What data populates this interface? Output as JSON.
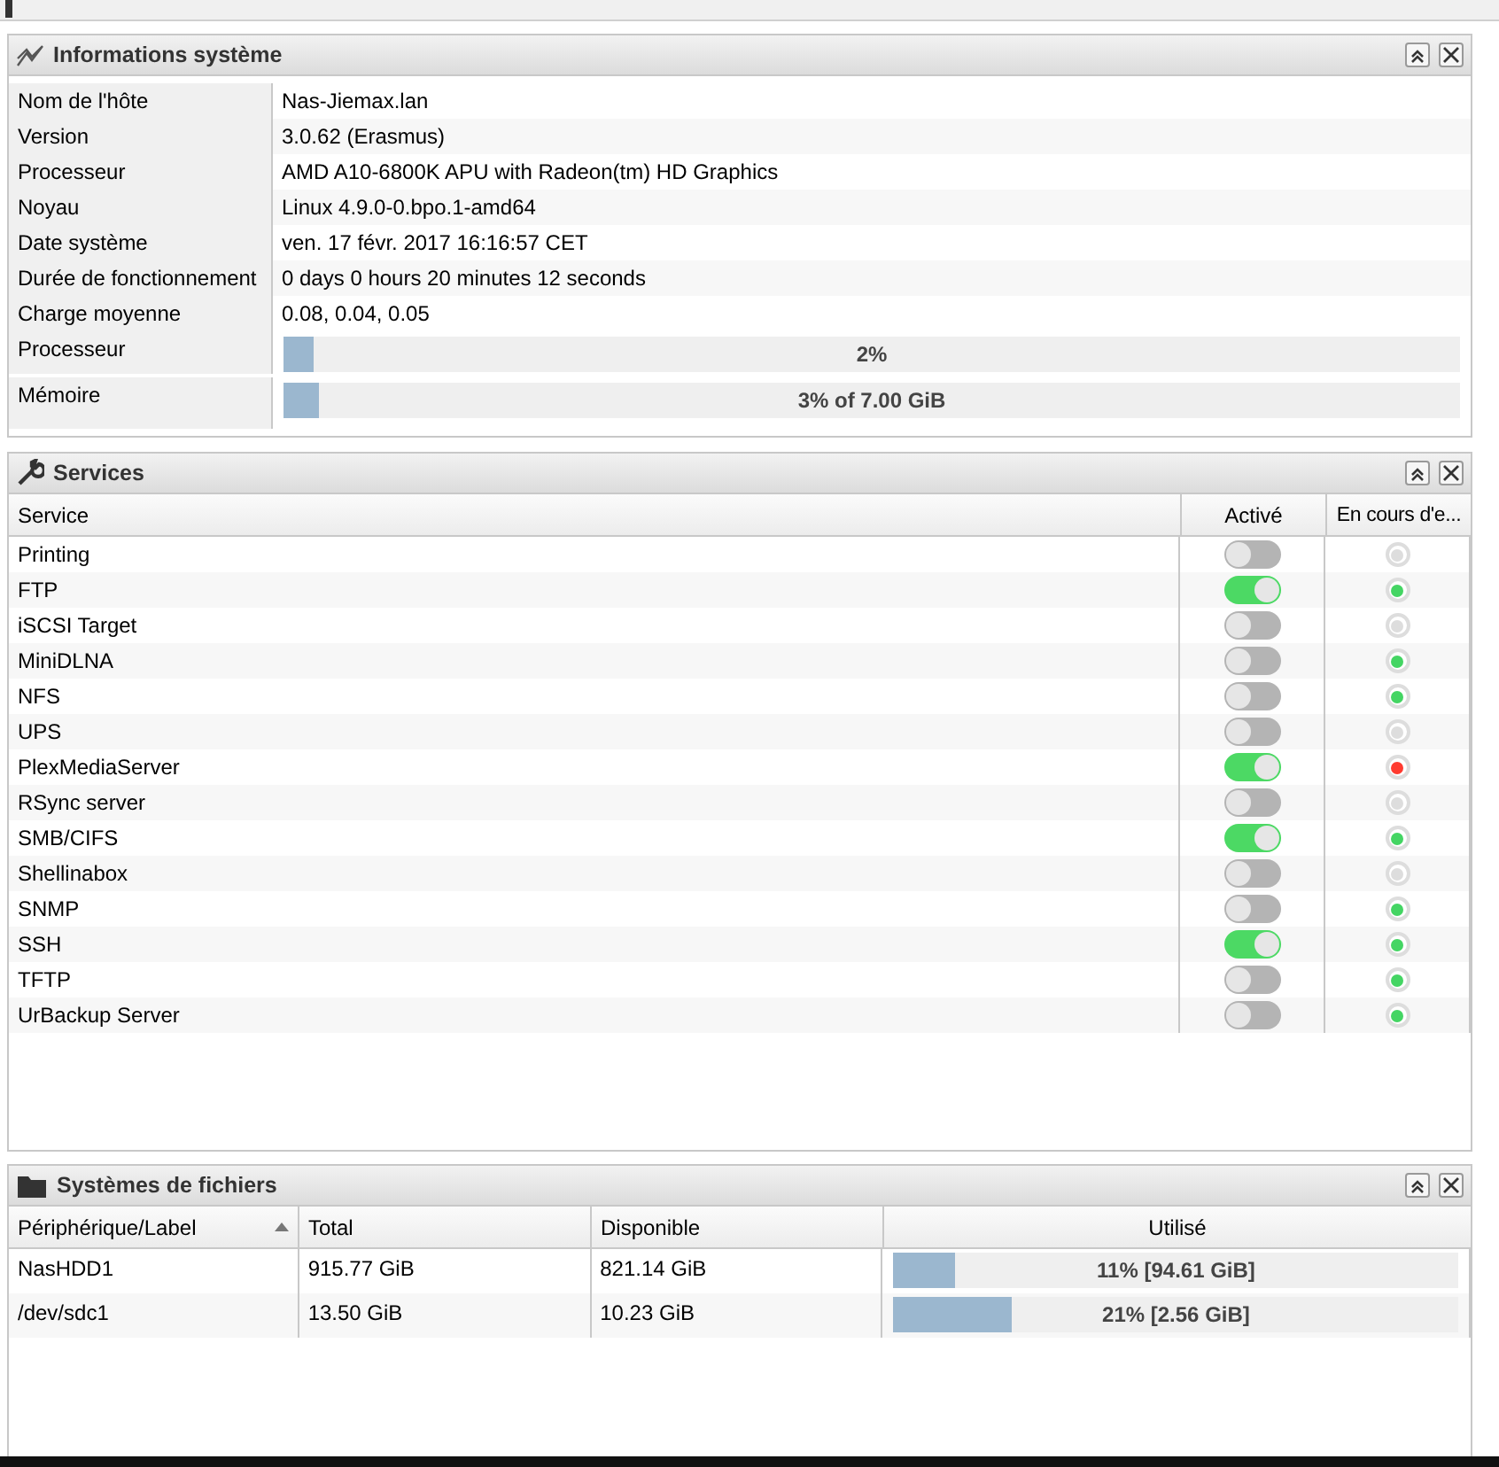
{
  "system_panel": {
    "title": "Informations système",
    "rows": [
      {
        "kind": "text",
        "label": "Nom de l'hôte",
        "value": "Nas-Jiemax.lan"
      },
      {
        "kind": "text",
        "label": "Version",
        "value": "3.0.62 (Erasmus)"
      },
      {
        "kind": "text",
        "label": "Processeur",
        "value": "AMD A10-6800K APU with Radeon(tm) HD Graphics"
      },
      {
        "kind": "text",
        "label": "Noyau",
        "value": "Linux 4.9.0-0.bpo.1-amd64"
      },
      {
        "kind": "text",
        "label": "Date système",
        "value": "ven. 17 févr. 2017 16:16:57 CET"
      },
      {
        "kind": "text",
        "label": "Durée de fonctionnement",
        "value": "0 days 0 hours 20 minutes 12 seconds"
      },
      {
        "kind": "text",
        "label": "Charge moyenne",
        "value": "0.08, 0.04, 0.05"
      },
      {
        "kind": "bar",
        "label": "Processeur",
        "level": 0.02,
        "value": "2%"
      },
      {
        "kind": "bar",
        "label": "Mémoire",
        "level": 0.03,
        "value": "3% of 7.00 GiB"
      }
    ]
  },
  "services_panel": {
    "title": "Services",
    "columns": [
      "Service",
      "Activé",
      "En cours d'e..."
    ],
    "rows": [
      {
        "name": "Printing",
        "enabled": false,
        "color": "#dddddd"
      },
      {
        "name": "FTP",
        "enabled": true,
        "color": "#44d563"
      },
      {
        "name": "iSCSI Target",
        "enabled": false,
        "color": "#dddddd"
      },
      {
        "name": "MiniDLNA",
        "enabled": false,
        "color": "#44d563"
      },
      {
        "name": "NFS",
        "enabled": false,
        "color": "#44d563"
      },
      {
        "name": "UPS",
        "enabled": false,
        "color": "#dddddd"
      },
      {
        "name": "PlexMediaServer",
        "enabled": true,
        "color": "#ff3b30"
      },
      {
        "name": "RSync server",
        "enabled": false,
        "color": "#dddddd"
      },
      {
        "name": "SMB/CIFS",
        "enabled": true,
        "color": "#44d563"
      },
      {
        "name": "Shellinabox",
        "enabled": false,
        "color": "#dddddd"
      },
      {
        "name": "SNMP",
        "enabled": false,
        "color": "#44d563"
      },
      {
        "name": "SSH",
        "enabled": true,
        "color": "#44d563"
      },
      {
        "name": "TFTP",
        "enabled": false,
        "color": "#44d563"
      },
      {
        "name": "UrBackup Server",
        "enabled": false,
        "color": "#44d563"
      }
    ]
  },
  "filesystems_panel": {
    "title": "Systèmes de fichiers",
    "columns": [
      "Périphérique/Label",
      "Total",
      "Disponible",
      "Utilisé"
    ],
    "rows": [
      {
        "device": "NasHDD1",
        "total": "915.77 GiB",
        "available": "821.14 GiB",
        "level": 0.11,
        "used": "11% [94.61 GiB]"
      },
      {
        "device": "/dev/sdc1",
        "total": "13.50 GiB",
        "available": "10.23 GiB",
        "level": 0.21,
        "used": "21% [2.56 GiB]"
      }
    ]
  }
}
